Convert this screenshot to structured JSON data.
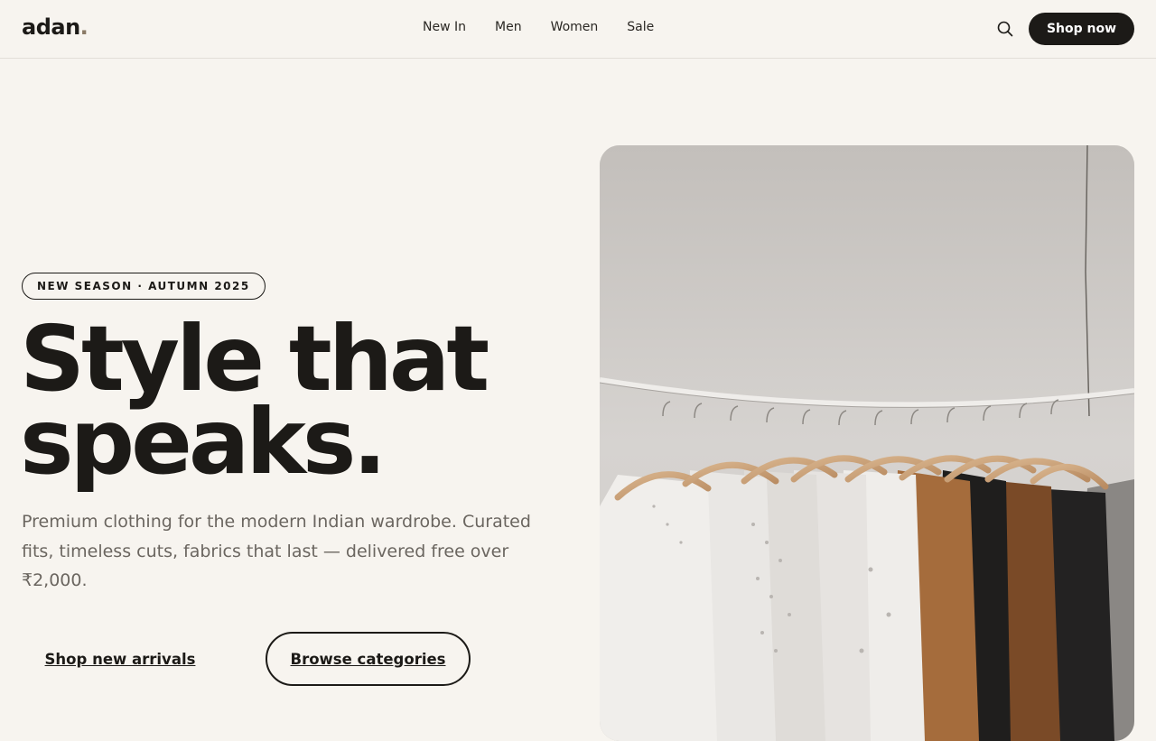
{
  "header": {
    "logo_text": "adan",
    "logo_dot": ".",
    "nav": [
      {
        "label": "New In"
      },
      {
        "label": "Men"
      },
      {
        "label": "Women"
      },
      {
        "label": "Sale"
      }
    ],
    "search_icon": "search-icon",
    "cta_label": "Shop now"
  },
  "hero": {
    "badge": "NEW SEASON · AUTUMN 2025",
    "headline_line1": "Style that",
    "headline_line2": "speaks.",
    "subtext": "Premium clothing for the modern Indian wardrobe. Curated fits, timeless cuts, fabrics that last — delivered free over ₹2,000.",
    "primary_button": "Shop new arrivals",
    "secondary_button": "Browse categories",
    "image_subject": "clothes-rack-photo"
  },
  "colors": {
    "background": "#f7f4ef",
    "text": "#1c1a17",
    "muted_text": "#6b6660",
    "accent_dot": "#8a7a66",
    "button_dark": "#1c1a17"
  }
}
